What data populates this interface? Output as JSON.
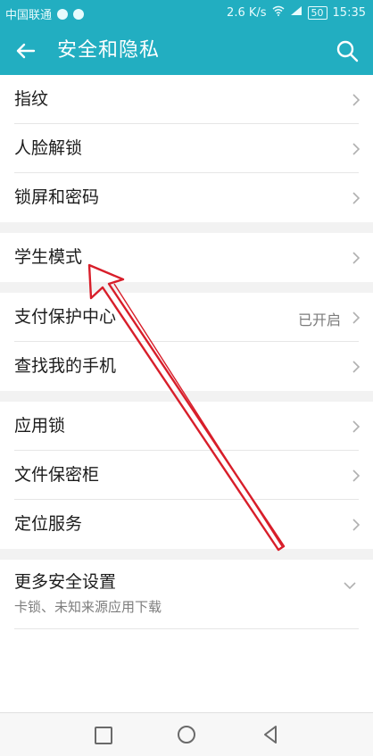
{
  "status_bar": {
    "carrier": "中国联通",
    "speed": "2.6 K/s",
    "battery": "50",
    "time": "15:35"
  },
  "app_bar": {
    "title": "安全和隐私",
    "back_icon": "arrow-left-icon",
    "search_icon": "search-icon"
  },
  "groups": [
    {
      "items": [
        {
          "label": "指纹"
        },
        {
          "label": "人脸解锁"
        },
        {
          "label": "锁屏和密码"
        }
      ]
    },
    {
      "items": [
        {
          "label": "学生模式"
        }
      ]
    },
    {
      "items": [
        {
          "label": "支付保护中心",
          "value": "已开启"
        },
        {
          "label": "查找我的手机"
        }
      ]
    },
    {
      "items": [
        {
          "label": "应用锁"
        },
        {
          "label": "文件保密柜"
        },
        {
          "label": "定位服务"
        }
      ]
    }
  ],
  "more": {
    "label": "更多安全设置",
    "sub": "卡锁、未知来源应用下载"
  },
  "colors": {
    "accent": "#22aec1",
    "annotation_arrow": "#d81e2a"
  }
}
